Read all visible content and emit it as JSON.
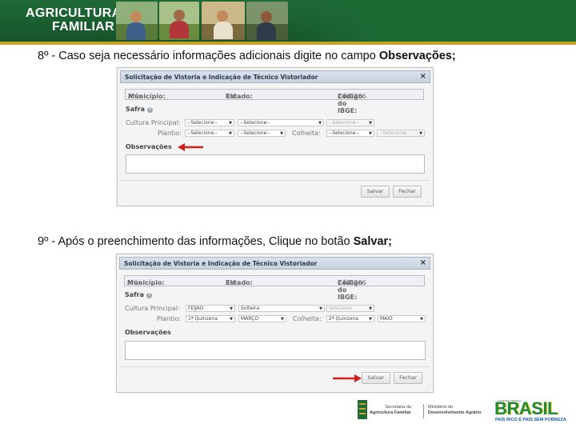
{
  "header": {
    "logo_line1": "AGRICULTURA",
    "logo_line2": "FAMILIAR"
  },
  "step8": {
    "text_prefix": "8º - Caso seja necessário informações adicionais digite no campo ",
    "text_bold": "Observações;"
  },
  "step9": {
    "text_prefix": "9º - Após o preenchimento das informações, Clique no botão ",
    "text_bold": "Salvar;"
  },
  "dialog1": {
    "title": "Solicitação de Vistoria e Indicação de Técnico Vistoriador",
    "close": "×",
    "municipio_label": "Município:",
    "municipio_value": "Arês",
    "estado_label": "Estado:",
    "estado_value": "RN",
    "ibge_label": "Código do IBGE:",
    "ibge_value": "2401206",
    "safra_label": "Safra",
    "cultura_label": "Cultura Principal:",
    "plantio_label": "Plantio:",
    "colheita_label": "Colheita:",
    "cultura_sel1": "--Selecione--",
    "cultura_sel2": "--Selecione--",
    "cultura_sel3": "--Selecione--",
    "plantio_sel1": "--Selecione--",
    "plantio_sel2": "--Selecione--",
    "colheita_sel1": "--Selecione--",
    "colheita_sel2": "--Selecione--",
    "obs_label": "Observações",
    "salvar": "Salvar",
    "fechar": "Fechar"
  },
  "dialog2": {
    "title": "Solicitação de Vistoria e Indicação de Técnico Vistoriador",
    "close": "×",
    "municipio_label": "Município:",
    "municipio_value": "Arês",
    "estado_label": "Estado:",
    "estado_value": "RN",
    "ibge_label": "Código do IBGE:",
    "ibge_value": "2401206",
    "safra_label": "Safra",
    "cultura_label": "Cultura Principal:",
    "plantio_label": "Plantio:",
    "colheita_label": "Colheita:",
    "cultura_sel1": "FEIJAO",
    "cultura_sel2": "Solteira",
    "cultura_sel3": "Selecione",
    "plantio_sel1": "1ª Quinzena",
    "plantio_sel2": "MARÇO",
    "colheita_sel1": "2ª Quinzena",
    "colheita_sel2": "MAIO",
    "obs_label": "Observações",
    "salvar": "Salvar",
    "fechar": "Fechar"
  },
  "footer": {
    "sec_line1": "Secretaria da",
    "sec_line2": "Agricultura Familiar",
    "min_line1": "Ministério do",
    "min_line2": "Desenvolvimento Agrário",
    "gov_tag": "GOVERNO FEDERAL",
    "brasil_word": "BRASIL",
    "brasil_tagline": "PAÍS RICO É PAÍS SEM POBREZA"
  },
  "colors": {
    "banner_green": "#1f6b36",
    "arrow_red": "#d0201c",
    "brasil_green": "#1e8a3c",
    "brasil_yellow": "#f2c300",
    "brasil_blue": "#1d5aa8"
  },
  "icons": [
    "help-icon",
    "close-icon",
    "dropdown-arrow-icon",
    "resize-grip-icon",
    "red-arrow-icon"
  ]
}
